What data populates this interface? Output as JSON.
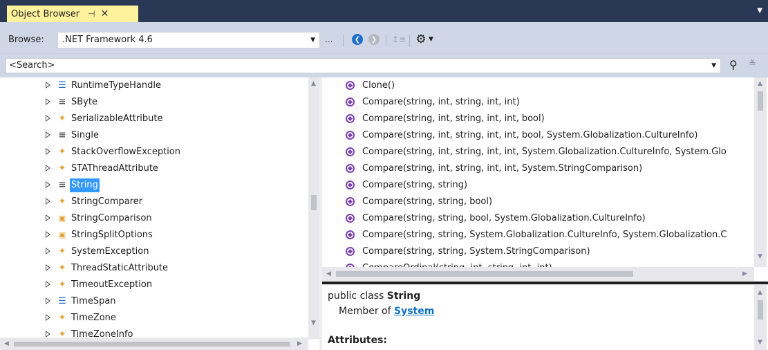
{
  "tab": {
    "title": "Object Browser",
    "pin_glyph": "⊣",
    "close_glyph": "✕"
  },
  "toolbar": {
    "browse_label": "Browse:",
    "browse_value": ".NET Framework 4.6",
    "ellipsis": "...",
    "icons": [
      "back-icon",
      "forward-icon",
      "sort-icon",
      "gear-icon"
    ]
  },
  "search": {
    "placeholder": "<Search>"
  },
  "tree": {
    "items": [
      {
        "label": "RuntimeTypeHandle",
        "icon": "struct-icon",
        "glyph": "☰"
      },
      {
        "label": "SByte",
        "icon": "valuetype-icon",
        "glyph": "≡"
      },
      {
        "label": "SerializableAttribute",
        "icon": "class-icon",
        "glyph": "✦"
      },
      {
        "label": "Single",
        "icon": "valuetype-icon",
        "glyph": "≡"
      },
      {
        "label": "StackOverflowException",
        "icon": "class-icon",
        "glyph": "✦"
      },
      {
        "label": "STAThreadAttribute",
        "icon": "class-icon",
        "glyph": "✦"
      },
      {
        "label": "String",
        "icon": "valuetype-icon",
        "glyph": "≡",
        "selected": true
      },
      {
        "label": "StringComparer",
        "icon": "class-icon",
        "glyph": "✦"
      },
      {
        "label": "StringComparison",
        "icon": "enum-icon",
        "glyph": "▣"
      },
      {
        "label": "StringSplitOptions",
        "icon": "enum-icon",
        "glyph": "▣"
      },
      {
        "label": "SystemException",
        "icon": "class-icon",
        "glyph": "✦"
      },
      {
        "label": "ThreadStaticAttribute",
        "icon": "class-icon",
        "glyph": "✦"
      },
      {
        "label": "TimeoutException",
        "icon": "class-icon",
        "glyph": "✦"
      },
      {
        "label": "TimeSpan",
        "icon": "struct-icon",
        "glyph": "☰"
      },
      {
        "label": "TimeZone",
        "icon": "class-icon",
        "glyph": "✦"
      },
      {
        "label": "TimeZoneInfo",
        "icon": "class-icon",
        "glyph": "✦"
      }
    ]
  },
  "members": {
    "items": [
      "Clone()",
      "Compare(string, int, string, int, int)",
      "Compare(string, int, string, int, int, bool)",
      "Compare(string, int, string, int, int, bool, System.Globalization.CultureInfo)",
      "Compare(string, int, string, int, int, System.Globalization.CultureInfo, System.Glo",
      "Compare(string, int, string, int, int, System.StringComparison)",
      "Compare(string, string)",
      "Compare(string, string, bool)",
      "Compare(string, string, bool, System.Globalization.CultureInfo)",
      "Compare(string, string, System.Globalization.CultureInfo, System.Globalization.C",
      "Compare(string, string, System.StringComparison)",
      "CompareOrdinal(string, int, string, int, int)"
    ]
  },
  "description": {
    "prefix": "public class ",
    "name": "String",
    "member_of_label": "Member of ",
    "member_of_link": "System",
    "attributes_heading": "Attributes:"
  },
  "colors": {
    "tab_active": "#fff29d",
    "selection": "#3399ff",
    "link": "#0e70c0",
    "class_icon": "#e0a132",
    "struct_icon": "#1e6fcc",
    "method_icon": "#7c3fb0"
  }
}
